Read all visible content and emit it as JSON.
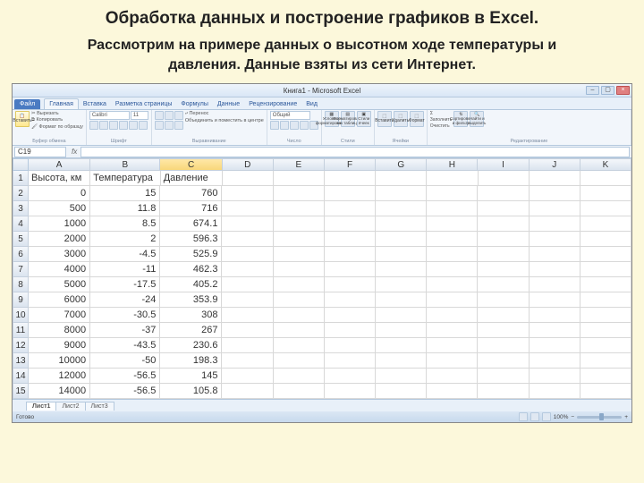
{
  "slide": {
    "title": "Обработка данных и построение графиков в Excel.",
    "subtitle": "Рассмотрим на примере данных о высотном ходе температуры и давления. Данные взяты из сети Интернет."
  },
  "window": {
    "title": "Книга1 - Microsoft Excel"
  },
  "tabs": {
    "file": "Файл",
    "items": [
      "Главная",
      "Вставка",
      "Разметка страницы",
      "Формулы",
      "Данные",
      "Рецензирование",
      "Вид"
    ]
  },
  "ribbon": {
    "clipboard": {
      "paste": "Вставить",
      "cut": "Вырезать",
      "copy": "Копировать",
      "brush": "Формат по образцу",
      "label": "Буфер обмена"
    },
    "font": {
      "name": "Calibri",
      "size": "11",
      "label": "Шрифт"
    },
    "align": {
      "merge": "Объединить и поместить в центре",
      "label": "Выравнивание"
    },
    "number": {
      "format": "Общий",
      "label": "Число"
    },
    "styles": {
      "cond": "Условное форматирование",
      "fmt": "Форматировать как таблицу",
      "cell": "Стили ячеек",
      "label": "Стили"
    },
    "cells": {
      "insert": "Вставить",
      "delete": "Удалить",
      "format": "Формат",
      "label": "Ячейки"
    },
    "editing": {
      "sum": "Σ",
      "fill": "Заполнить",
      "clear": "Очистить",
      "sort": "Сортировка и фильтр",
      "find": "Найти и выделить",
      "label": "Редактирование"
    }
  },
  "namebox": "C19",
  "columns": [
    "A",
    "B",
    "C",
    "D",
    "E",
    "F",
    "G",
    "H",
    "I",
    "J",
    "K"
  ],
  "rownums": [
    "1",
    "2",
    "3",
    "4",
    "5",
    "6",
    "7",
    "8",
    "9",
    "10",
    "11",
    "12",
    "13",
    "14",
    "15"
  ],
  "table": {
    "headers": {
      "A": "Высота, км",
      "B": "Температура",
      "C": "Давление"
    },
    "rows": [
      {
        "A": "0",
        "B": "15",
        "C": "760"
      },
      {
        "A": "500",
        "B": "11.8",
        "C": "716"
      },
      {
        "A": "1000",
        "B": "8.5",
        "C": "674.1"
      },
      {
        "A": "2000",
        "B": "2",
        "C": "596.3"
      },
      {
        "A": "3000",
        "B": "-4.5",
        "C": "525.9"
      },
      {
        "A": "4000",
        "B": "-11",
        "C": "462.3"
      },
      {
        "A": "5000",
        "B": "-17.5",
        "C": "405.2"
      },
      {
        "A": "6000",
        "B": "-24",
        "C": "353.9"
      },
      {
        "A": "7000",
        "B": "-30.5",
        "C": "308"
      },
      {
        "A": "8000",
        "B": "-37",
        "C": "267"
      },
      {
        "A": "9000",
        "B": "-43.5",
        "C": "230.6"
      },
      {
        "A": "10000",
        "B": "-50",
        "C": "198.3"
      },
      {
        "A": "12000",
        "B": "-56.5",
        "C": "145"
      },
      {
        "A": "14000",
        "B": "-56.5",
        "C": "105.8"
      }
    ]
  },
  "sheets": [
    "Лист1",
    "Лист2",
    "Лист3"
  ],
  "status": {
    "ready": "Готово",
    "zoom": "100%"
  }
}
